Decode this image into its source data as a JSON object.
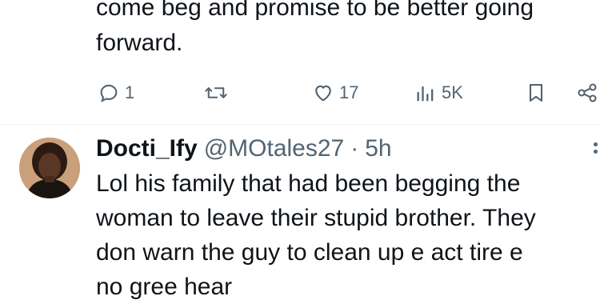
{
  "previous_tweet": {
    "text_lines": [
      "come beg and promise to be better going",
      "forward."
    ],
    "actions": {
      "reply_count": "1",
      "like_count": "17",
      "views_count": "5K"
    }
  },
  "reply_tweet": {
    "display_name": "Docti_Ify",
    "handle": "@MOtales27",
    "separator": "·",
    "time": "5h",
    "text_lines": [
      "Lol his family that had been begging the",
      "woman to leave their stupid brother. They",
      "don warn the guy to clean up e act tire e",
      "no gree hear"
    ]
  },
  "icons": {
    "reply": "speech-bubble-icon",
    "retweet": "retweet-icon",
    "like": "heart-icon",
    "views": "bar-chart-icon",
    "bookmark": "bookmark-icon",
    "share": "share-icon",
    "more": "more-dots-icon"
  },
  "colors": {
    "text_primary": "#0f1419",
    "text_secondary": "#536471",
    "divider": "#eff3f4"
  }
}
